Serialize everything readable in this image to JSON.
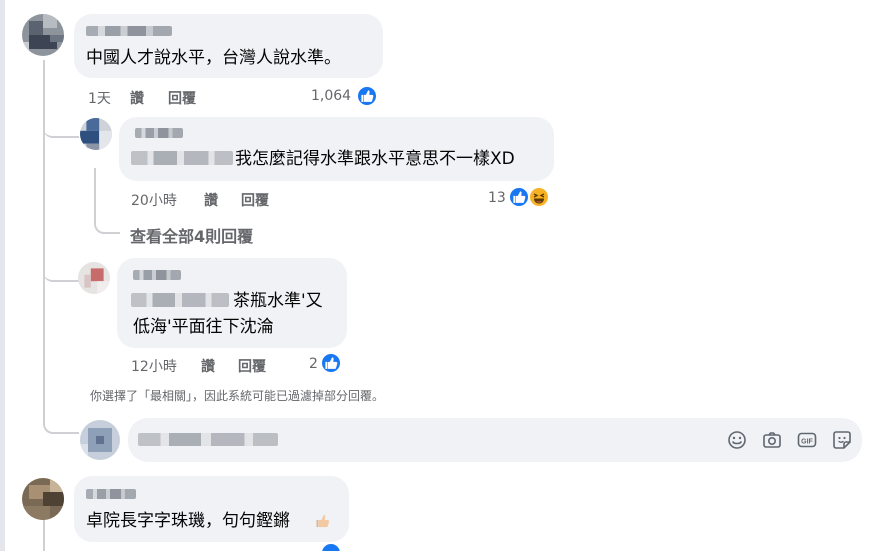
{
  "comments": [
    {
      "text": "中國人才說水平，台灣人說水準。",
      "time": "1天",
      "like_label": "讚",
      "reply_label": "回覆",
      "reaction_count": "1,064"
    },
    {
      "text": "我怎麼記得水準跟水平意思不一樣XD",
      "time": "20小時",
      "like_label": "讚",
      "reply_label": "回覆",
      "reaction_count": "13"
    },
    {
      "text_line1": "茶瓶水準'又",
      "text_line2": "低海'平面往下沈淪",
      "time": "12小時",
      "like_label": "讚",
      "reply_label": "回覆",
      "reaction_count": "2"
    },
    {
      "text": "卓院長字字珠璣，句句鏗鏘"
    }
  ],
  "see_all_replies": "查看全部4則回覆",
  "filter_note": "你選擇了「最相關」，因此系統可能已過濾掉部分回覆。",
  "reply_input": {
    "tools": [
      "emoji-icon",
      "camera-icon",
      "gif-icon",
      "sticker-icon"
    ],
    "gif_text": "GIF"
  },
  "colors": {
    "like_blue": "#1877f2",
    "bubble_gray": "#f0f2f5",
    "meta_gray": "#65676b"
  }
}
